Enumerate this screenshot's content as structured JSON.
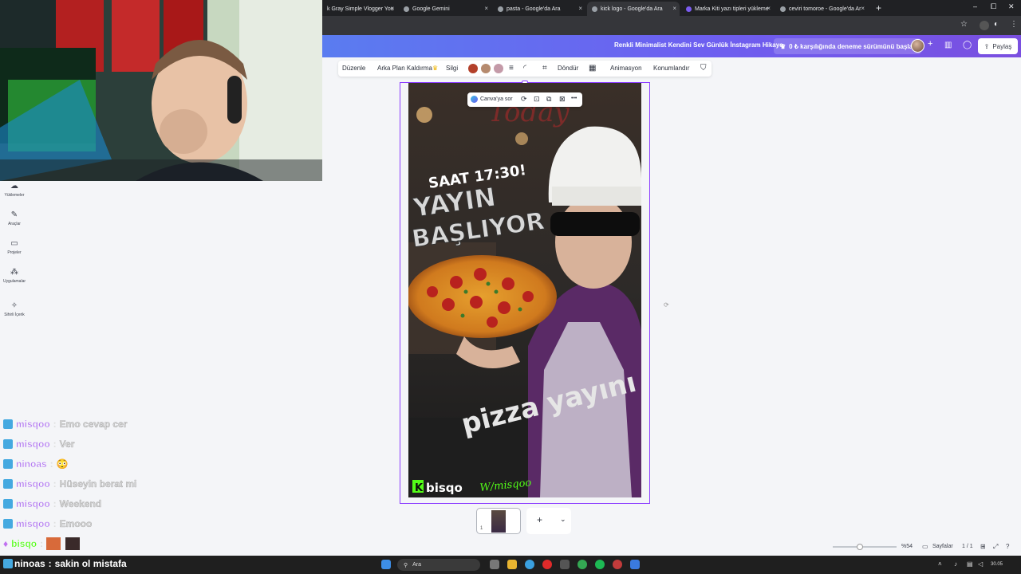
{
  "browser": {
    "tabs": [
      {
        "label": "k Gray Simple Vlogger You"
      },
      {
        "label": "Google Gemini"
      },
      {
        "label": "pasta - Google'da Ara"
      },
      {
        "label": "kick logo - Google'da Ara"
      },
      {
        "label": "Marka Kiti yazı tipleri yükleme"
      },
      {
        "label": "ceviri tomoroe - Google'da Ar"
      }
    ],
    "new_tab": "+",
    "minimize": "–",
    "maximize": "⧠",
    "close": "✕"
  },
  "header": {
    "title": "Renkli Minimalist Kendini Sev Günlük İnstagram Hikaye",
    "trial": "0 ₺ karşılığında deneme sürümünü başlat",
    "plus": "+",
    "share": "Paylaş"
  },
  "toolbar": {
    "edit": "Düzenle",
    "bg_remove": "Arka Plan Kaldırma",
    "eraser": "Silgi",
    "rotate": "Döndür",
    "animation": "Animasyon",
    "position": "Konumlandır",
    "swatches": [
      "#b3402a",
      "#b58a6e",
      "#c49aa8"
    ]
  },
  "sidebar": {
    "items": [
      {
        "label": "Yüklemeler",
        "icon": "cloud-upload-icon"
      },
      {
        "label": "Araçlar",
        "icon": "pen-icon"
      },
      {
        "label": "Projeler",
        "icon": "folder-icon"
      },
      {
        "label": "Uygulamalar",
        "icon": "apps-icon"
      },
      {
        "label": "Sihirli İçerik",
        "icon": "magic-icon"
      }
    ]
  },
  "context_menu": {
    "ask": "Canva'ya sor",
    "more": "•••"
  },
  "design": {
    "top_word": "Today",
    "time": "SAAT 17:30!",
    "line1": "YAYIN",
    "line2": "BAŞLIYOR",
    "pizza": "pizza yayını",
    "brand_k": "K",
    "brand": "bisqo",
    "signature": "W/misqoo"
  },
  "pages": {
    "thumb_number": "1",
    "add": "+",
    "chevron": "⌄"
  },
  "zoom": {
    "percent": "%54",
    "pages_label": "Sayfalar",
    "page_count": "1 / 1"
  },
  "chat": [
    {
      "user": "misqoo",
      "message": "Emo cevap cer"
    },
    {
      "user": "misqoo",
      "message": "Ver"
    },
    {
      "user": "ninoas",
      "message": "😳"
    },
    {
      "user": "misqoo",
      "message": "Hüseyin berat mi"
    },
    {
      "user": "misqoo",
      "message": "Weekend"
    },
    {
      "user": "misqoo",
      "message": "Emooo"
    },
    {
      "user": "bisqo",
      "message": ""
    }
  ],
  "bottom_chat": {
    "user": "ninoas",
    "message": "sakin ol mistafa"
  },
  "taskbar": {
    "search": "Ara",
    "clock": "30.05"
  }
}
